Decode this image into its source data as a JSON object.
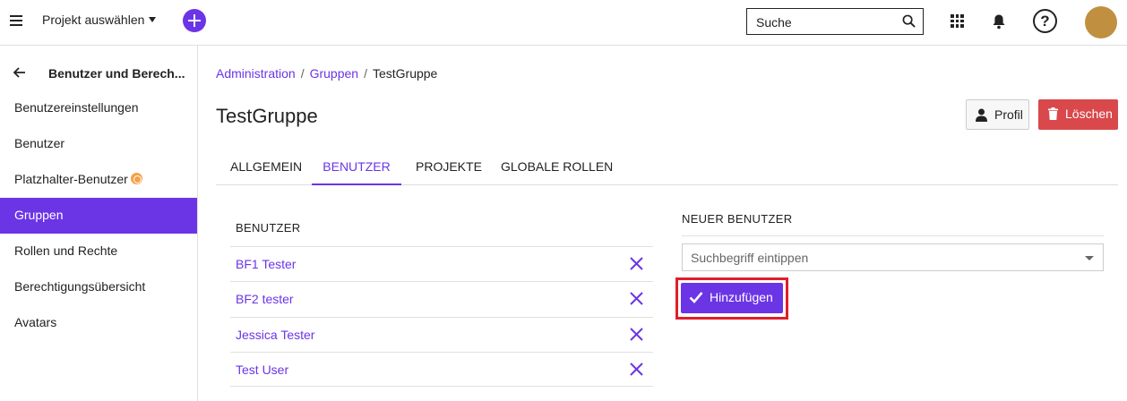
{
  "topbar": {
    "project_select_label": "Projekt auswählen",
    "search_placeholder": "Suche",
    "avatar_color": "#c09040"
  },
  "sidebar": {
    "title": "Benutzer und Berech...",
    "items": [
      {
        "label": "Benutzereinstellungen"
      },
      {
        "label": "Benutzer"
      },
      {
        "label": "Platzhalter-Benutzer",
        "badge": "enterprise-icon"
      },
      {
        "label": "Gruppen",
        "active": true
      },
      {
        "label": "Rollen und Rechte"
      },
      {
        "label": "Berechtigungsübersicht"
      },
      {
        "label": "Avatars"
      }
    ]
  },
  "breadcrumb": [
    "Administration",
    "Gruppen",
    "TestGruppe"
  ],
  "page": {
    "title": "TestGruppe",
    "profile_button": "Profil",
    "delete_button": "Löschen"
  },
  "tabs": [
    {
      "label": "ALLGEMEIN"
    },
    {
      "label": "BENUTZER",
      "active": true
    },
    {
      "label": "PROJEKTE"
    },
    {
      "label": "GLOBALE ROLLEN"
    }
  ],
  "users_section": {
    "heading": "BENUTZER",
    "users": [
      "BF1 Tester",
      "BF2 tester",
      "Jessica Tester",
      "Test User"
    ]
  },
  "new_user_section": {
    "heading": "NEUER BENUTZER",
    "search_placeholder": "Suchbegriff eintippen",
    "add_button": "Hinzufügen"
  },
  "colors": {
    "accent": "#6b35e6",
    "danger": "#d9484b",
    "highlight": "#e01e2a"
  }
}
